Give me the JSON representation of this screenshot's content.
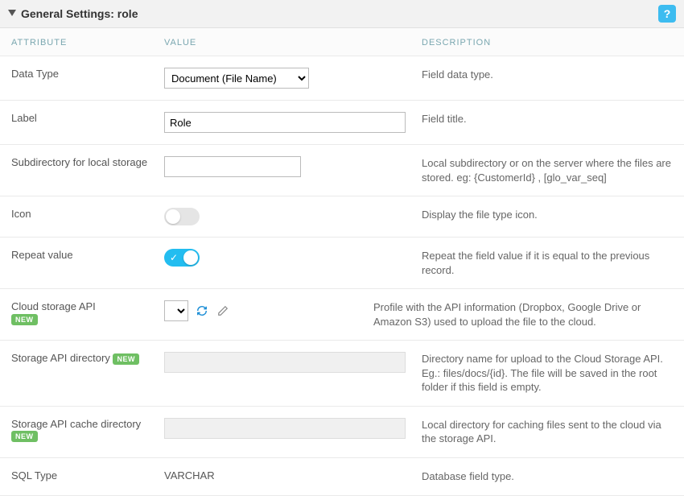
{
  "header": {
    "title": "General Settings: role",
    "help_label": "?"
  },
  "columns": {
    "attribute": "ATTRIBUTE",
    "value": "VALUE",
    "description": "DESCRIPTION"
  },
  "rows": {
    "dataType": {
      "label": "Data Type",
      "value": "Document (File Name)",
      "desc": "Field data type."
    },
    "label": {
      "label": "Label",
      "value": "Role",
      "desc": "Field title."
    },
    "subdir": {
      "label": "Subdirectory for local storage",
      "value": "",
      "desc": "Local subdirectory or on the server where the files are stored. eg: {CustomerId} , [glo_var_seq]"
    },
    "icon": {
      "label": "Icon",
      "value": "off",
      "desc": "Display the file type icon."
    },
    "repeat": {
      "label": "Repeat value",
      "value": "on",
      "desc": "Repeat the field value if it is equal to the previous record."
    },
    "cloudApi": {
      "label": "Cloud storage API",
      "badge": "NEW",
      "value": "",
      "desc": "Profile with the API information (Dropbox, Google Drive or Amazon S3) used to upload the file to the cloud."
    },
    "storageDir": {
      "label": "Storage API directory",
      "badge": "NEW",
      "value": "",
      "desc": "Directory name for upload to the Cloud Storage API. Eg.: files/docs/{id}. The file will be saved in the root folder if this field is empty."
    },
    "storageCache": {
      "label": "Storage API cache directory",
      "badge": "NEW",
      "value": "",
      "desc": "Local directory for caching files sent to the cloud via the storage API."
    },
    "sqlType": {
      "label": "SQL Type",
      "value": "VARCHAR",
      "desc": "Database field type."
    }
  }
}
